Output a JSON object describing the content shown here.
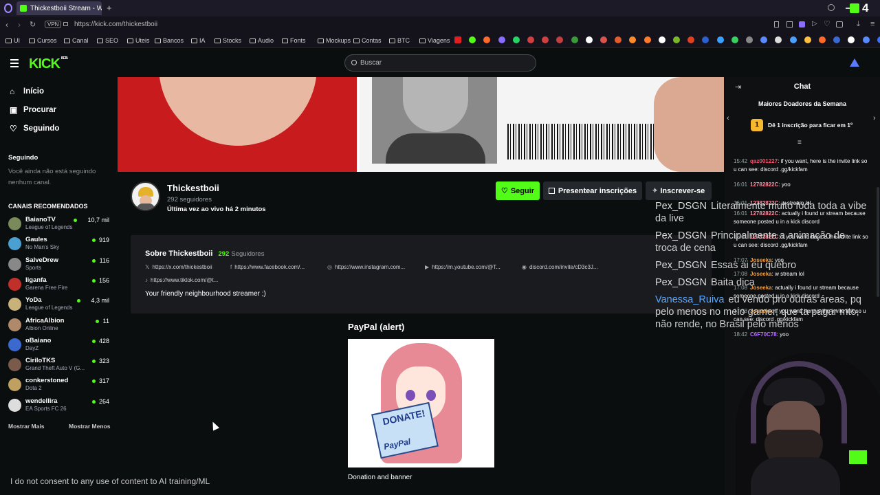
{
  "browser": {
    "tab_title": "Thickestboii Stream - Wat",
    "url": "https://kick.com/thickestboii",
    "vpn": "VPN",
    "bookmarks": [
      "UI",
      "Cursos",
      "Canal",
      "SEO",
      "Uteis",
      "Bancos",
      "IA",
      "Stocks",
      "Audio",
      "Fonts",
      "Mockups",
      "Contas",
      "BTC",
      "Viagens"
    ],
    "corner_badge": "4"
  },
  "header": {
    "logo": "KICK",
    "logo_badge": "BETA",
    "search_placeholder": "Buscar"
  },
  "sidebar": {
    "nav": [
      {
        "label": "Início",
        "icon": "home-icon"
      },
      {
        "label": "Procurar",
        "icon": "browse-icon"
      },
      {
        "label": "Seguindo",
        "icon": "heart-icon"
      }
    ],
    "following_title": "Seguindo",
    "following_empty": "Você ainda não está seguindo nenhum canal.",
    "recommended_title": "CANAIS RECOMENDADOS",
    "channels": [
      {
        "name": "BaianoTV",
        "game": "League of Legends",
        "viewers": "10,7 mil",
        "color": "#7a8a5a"
      },
      {
        "name": "Gaules",
        "game": "No Man's Sky",
        "viewers": "919",
        "color": "#4aa0d0"
      },
      {
        "name": "SalveDrew",
        "game": "Sports",
        "viewers": "116",
        "color": "#888888"
      },
      {
        "name": "liganfa",
        "game": "Garena Free Fire",
        "viewers": "156",
        "color": "#c0302a"
      },
      {
        "name": "YoDa",
        "game": "League of Legends",
        "viewers": "4,3 mil",
        "color": "#c9b27a"
      },
      {
        "name": "AfricaAlbion",
        "game": "Albion Online",
        "viewers": "11",
        "color": "#b0886a"
      },
      {
        "name": "oBaiano",
        "game": "DayZ",
        "viewers": "428",
        "color": "#3a6ad0"
      },
      {
        "name": "CiriloTKS",
        "game": "Grand Theft Auto V (G...",
        "viewers": "323",
        "color": "#7a5a4a"
      },
      {
        "name": "conkerstoned",
        "game": "Dota 2",
        "viewers": "317",
        "color": "#c0a060"
      },
      {
        "name": "wendellira",
        "game": "EA Sports FC 26",
        "viewers": "264",
        "color": "#dddddd"
      }
    ],
    "show_more": "Mostrar Mais",
    "show_less": "Mostrar Menos"
  },
  "channel": {
    "name": "Thickestboii",
    "followers": "292 seguidores",
    "last_live": "Última vez ao vivo há 2 minutos",
    "follow_button": "Seguir",
    "gift_button": "Presentear inscrições",
    "subscribe_button": "Inscrever-se"
  },
  "about": {
    "title": "Sobre Thickestboii",
    "followers_count": "292",
    "followers_label": "Seguidores",
    "links": [
      {
        "icon": "x-icon",
        "text": "https://x.com/thickestboii"
      },
      {
        "icon": "facebook-icon",
        "text": "https://www.facebook.com/..."
      },
      {
        "icon": "instagram-icon",
        "text": "https://www.instagram.com..."
      },
      {
        "icon": "youtube-icon",
        "text": "https://m.youtube.com/@T..."
      },
      {
        "icon": "discord-icon",
        "text": "discord.com/invite/cD3c3J..."
      },
      {
        "icon": "tiktok-icon",
        "text": "https://www.tiktok.com/@t..."
      }
    ],
    "bio": "Your friendly neighbourhood streamer ;)"
  },
  "panel": {
    "title": "PayPal (alert)",
    "image_text": "DONATE!",
    "image_brand": "PayPal",
    "caption": "Donation and banner"
  },
  "chat": {
    "title": "Chat",
    "donors_title": "Maiores Doadores da Semana",
    "donors_rank": "1",
    "donors_cta": "Dê 1 inscrição para ficar em 1º",
    "messages": [
      {
        "time": "15:42",
        "user": "qaz001227",
        "color": "#ff4d6a",
        "text": "if you want, here is the invite link so u can see: discord .gg/kickfam"
      },
      {
        "time": "16:01",
        "user": "12782822C",
        "color": "#ff8aa0",
        "text": "yoo"
      },
      {
        "time": "16:01",
        "user": "12782822C",
        "color": "#ff8aa0",
        "text": "w stream lol"
      },
      {
        "time": "16:01",
        "user": "12782822C",
        "color": "#ff8aa0",
        "text": "actually i found ur stream because someone posted u in a kick discord"
      },
      {
        "time": "16:01",
        "user": "12782822C",
        "color": "#ff8aa0",
        "text": "if you want, here is the invite link so u can see: discord .gg/kickfam"
      },
      {
        "time": "17:07",
        "user": "Joseeka",
        "color": "#f0a040",
        "text": "yoo"
      },
      {
        "time": "17:08",
        "user": "Joseeka",
        "color": "#f0a040",
        "text": "w stream lol"
      },
      {
        "time": "17:08",
        "user": "Joseeka",
        "color": "#f0a040",
        "text": "actually i found ur stream because someone posted u in a kick discord"
      },
      {
        "time": "17:08",
        "user": "Joseeka",
        "color": "#f0a040",
        "text": "if you want, here is the invite link so u can see: discord .gg/kickfam"
      },
      {
        "time": "18:42",
        "user": "C6F70C78",
        "color": "#b56cff",
        "text": "yoo"
      }
    ]
  },
  "overlay_chat": [
    {
      "user": "Pex_DSGN",
      "color": "#dddddd",
      "text": "Literalmente muito foda toda a vibe da live"
    },
    {
      "user": "Pex_DSGN",
      "color": "#dddddd",
      "text": "Principalmente a animação de troca de cena"
    },
    {
      "user": "Pex_DSGN",
      "color": "#dddddd",
      "text": "Essas ai eu quebro"
    },
    {
      "user": "Pex_DSGN",
      "color": "#dddddd",
      "text": "Baita dica"
    },
    {
      "user": "Vanessa_Ruiva",
      "color": "#5aa8ff",
      "text": "eu vendo pro outras áreas, pq pelo menos no meio gamer, que ta pagar mto, não rende, no Brasil pelo menos"
    }
  ],
  "footer_note": "I do not consent to any use of content to AI training/ML",
  "colors": {
    "accent": "#53fc18",
    "bg": "#0b0e0f",
    "panel": "#191b1f"
  }
}
